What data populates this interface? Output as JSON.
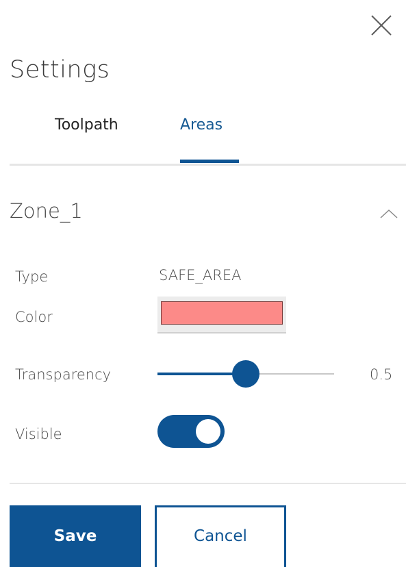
{
  "dialog": {
    "title": "Settings",
    "close_icon": "close-icon"
  },
  "tabs": [
    {
      "label": "Toolpath",
      "active": false
    },
    {
      "label": "Areas",
      "active": true
    }
  ],
  "zone": {
    "name": "Zone_1",
    "collapse_icon": "chevron-up-icon",
    "fields": {
      "type_label": "Type",
      "type_value": "SAFE_AREA",
      "color_label": "Color",
      "color_value": "#fc8a88",
      "transparency_label": "Transparency",
      "transparency_value": "0.5",
      "transparency_fraction": 0.5,
      "visible_label": "Visible",
      "visible_on": true
    }
  },
  "actions": {
    "save_label": "Save",
    "cancel_label": "Cancel"
  },
  "colors": {
    "accent": "#0e5493",
    "divider": "#e6e6e6"
  }
}
